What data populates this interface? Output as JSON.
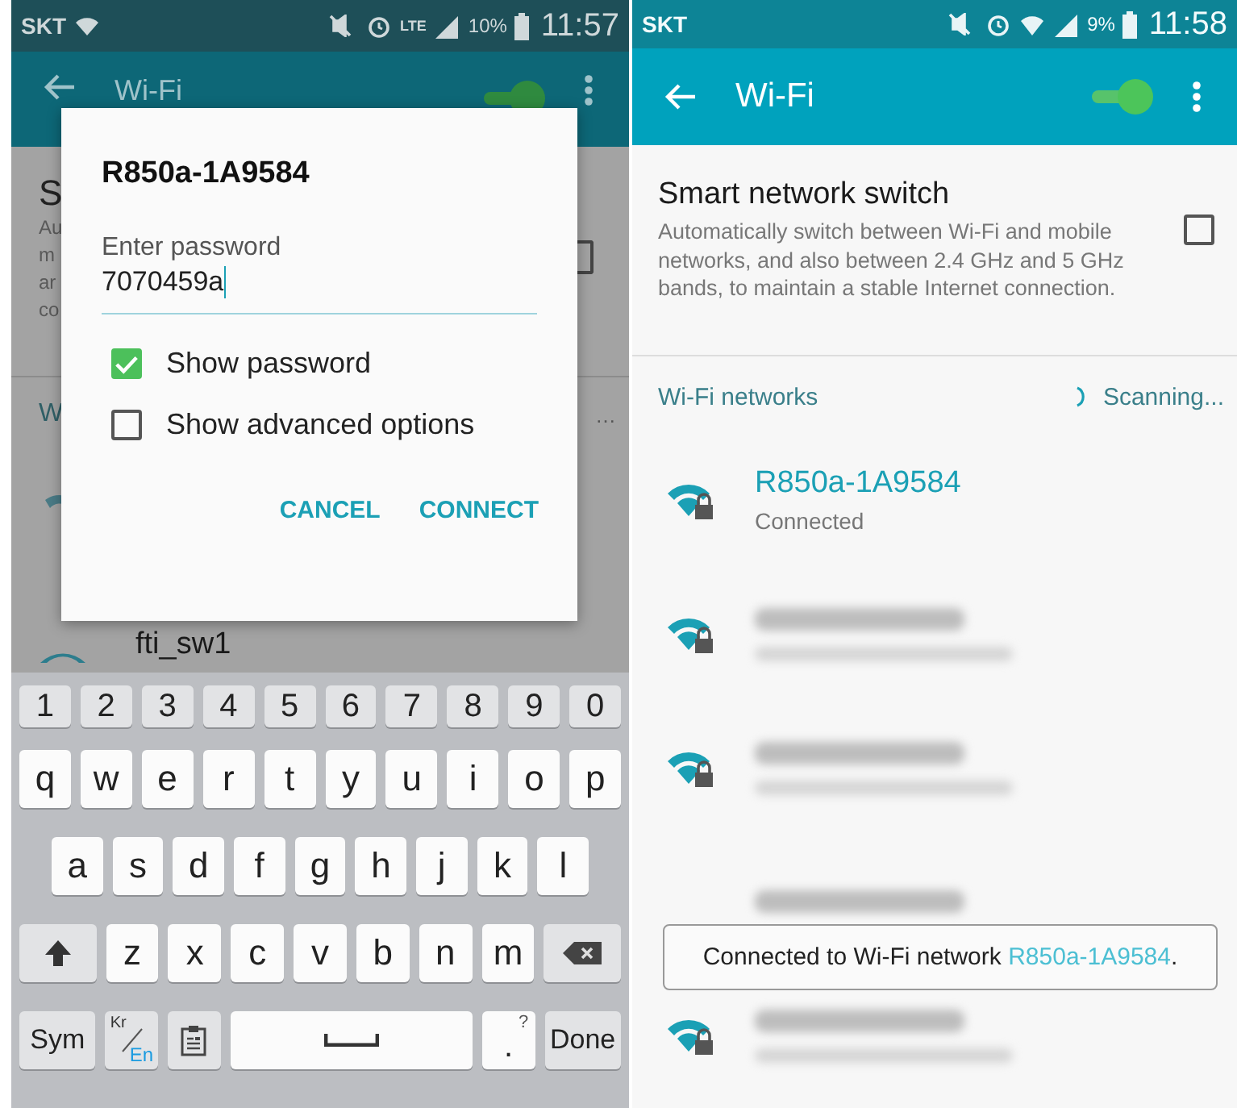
{
  "left_screen": {
    "status_bar": {
      "carrier": "SKT",
      "network": "LTE",
      "battery": "10%",
      "time": "11:57"
    },
    "app_bar": {
      "title": "Wi-Fi",
      "switch_on": true
    },
    "background_fragments": {
      "title": "S",
      "lines": [
        "Au",
        "m",
        "ar",
        "co"
      ],
      "section": "W",
      "trail": "…",
      "checked": false,
      "network": "fti_sw1"
    },
    "dialog": {
      "title": "R850a-1A9584",
      "label": "Enter password",
      "value": "7070459a",
      "options": [
        {
          "label": "Show password",
          "checked": true
        },
        {
          "label": "Show advanced options",
          "checked": false
        }
      ],
      "buttons": [
        "CANCEL",
        "CONNECT"
      ]
    },
    "keyboard": {
      "rows": [
        {
          "keys": [
            {
              "kind": "num",
              "label": "1"
            },
            {
              "kind": "num",
              "label": "2"
            },
            {
              "kind": "num",
              "label": "3"
            },
            {
              "kind": "num",
              "label": "4"
            },
            {
              "kind": "num",
              "label": "5"
            },
            {
              "kind": "num",
              "label": "6"
            },
            {
              "kind": "num",
              "label": "7"
            },
            {
              "kind": "num",
              "label": "8"
            },
            {
              "kind": "num",
              "label": "9"
            },
            {
              "kind": "num",
              "label": "0"
            }
          ]
        },
        {
          "keys": [
            {
              "kind": "char",
              "label": "q"
            },
            {
              "kind": "char",
              "label": "w"
            },
            {
              "kind": "char",
              "label": "e"
            },
            {
              "kind": "char",
              "label": "r"
            },
            {
              "kind": "char",
              "label": "t"
            },
            {
              "kind": "char",
              "label": "y"
            },
            {
              "kind": "char",
              "label": "u"
            },
            {
              "kind": "char",
              "label": "i"
            },
            {
              "kind": "char",
              "label": "o"
            },
            {
              "kind": "char",
              "label": "p"
            }
          ]
        },
        {
          "keys": [
            {
              "kind": "char",
              "label": "a"
            },
            {
              "kind": "char",
              "label": "s"
            },
            {
              "kind": "char",
              "label": "d"
            },
            {
              "kind": "char",
              "label": "f"
            },
            {
              "kind": "char",
              "label": "g"
            },
            {
              "kind": "char",
              "label": "h"
            },
            {
              "kind": "char",
              "label": "j"
            },
            {
              "kind": "char",
              "label": "k"
            },
            {
              "kind": "char",
              "label": "l"
            }
          ]
        },
        {
          "keys": [
            {
              "kind": "shift"
            },
            {
              "kind": "char",
              "label": "z"
            },
            {
              "kind": "char",
              "label": "x"
            },
            {
              "kind": "char",
              "label": "c"
            },
            {
              "kind": "char",
              "label": "v"
            },
            {
              "kind": "char",
              "label": "b"
            },
            {
              "kind": "char",
              "label": "n"
            },
            {
              "kind": "char",
              "label": "m"
            },
            {
              "kind": "backspace"
            }
          ]
        },
        {
          "keys": [
            {
              "kind": "sym",
              "label": "Sym"
            },
            {
              "kind": "lang",
              "label": "Kr",
              "sub": "En"
            },
            {
              "kind": "clipboard"
            },
            {
              "kind": "space"
            },
            {
              "kind": "period",
              "label": ".",
              "hint": "?"
            },
            {
              "kind": "done",
              "label": "Done"
            }
          ]
        }
      ]
    }
  },
  "right_screen": {
    "status_bar": {
      "carrier": "SKT",
      "battery": "9%",
      "time": "11:58"
    },
    "app_bar": {
      "title": "Wi-Fi",
      "switch_on": true
    },
    "smart_switch": {
      "title": "Smart network switch",
      "description": "Automatically switch between Wi-Fi and mobile networks, and also between 2.4 GHz and 5 GHz bands, to maintain a stable Internet connection.",
      "checked": false
    },
    "networks_header": {
      "title": "Wi-Fi networks",
      "status": "Scanning..."
    },
    "networks": [
      {
        "kind": "visible",
        "name": "R850a-1A9584",
        "status": "Connected",
        "connected": true
      },
      {
        "kind": "blurred"
      },
      {
        "kind": "blurred"
      },
      {
        "kind": "blurred_partial"
      },
      {
        "kind": "blurred"
      }
    ],
    "toast": {
      "prefix": "Connected to Wi-Fi network",
      "network": "R850a-1A9584",
      "suffix": "."
    }
  }
}
